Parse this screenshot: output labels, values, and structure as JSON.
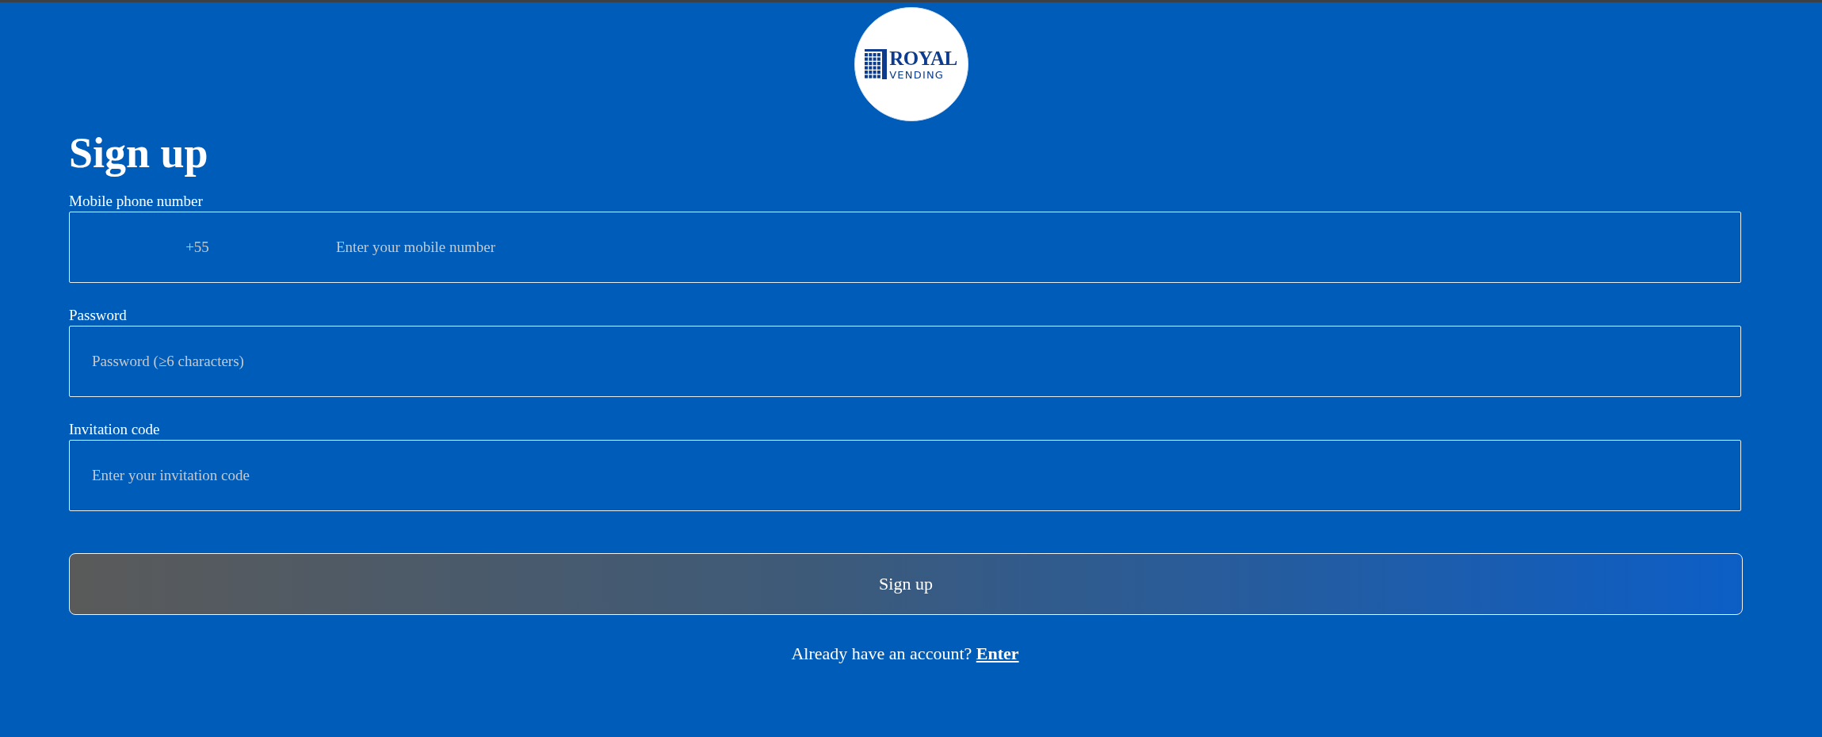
{
  "logo": {
    "line_1": "ROYAL",
    "line_2": "VENDING"
  },
  "title": "Sign up",
  "fields": [
    {
      "kind": "phone",
      "label": "Mobile phone number",
      "prefix": "+55",
      "placeholder": "Enter your mobile number"
    },
    {
      "kind": "password",
      "label": "Password",
      "placeholder": "Password (≥6 characters)"
    },
    {
      "kind": "text",
      "label": "Invitation code",
      "placeholder": "Enter your invitation code"
    }
  ],
  "submit_button": "Sign up",
  "footer": {
    "text": "Already have an account?",
    "link": "Enter"
  }
}
